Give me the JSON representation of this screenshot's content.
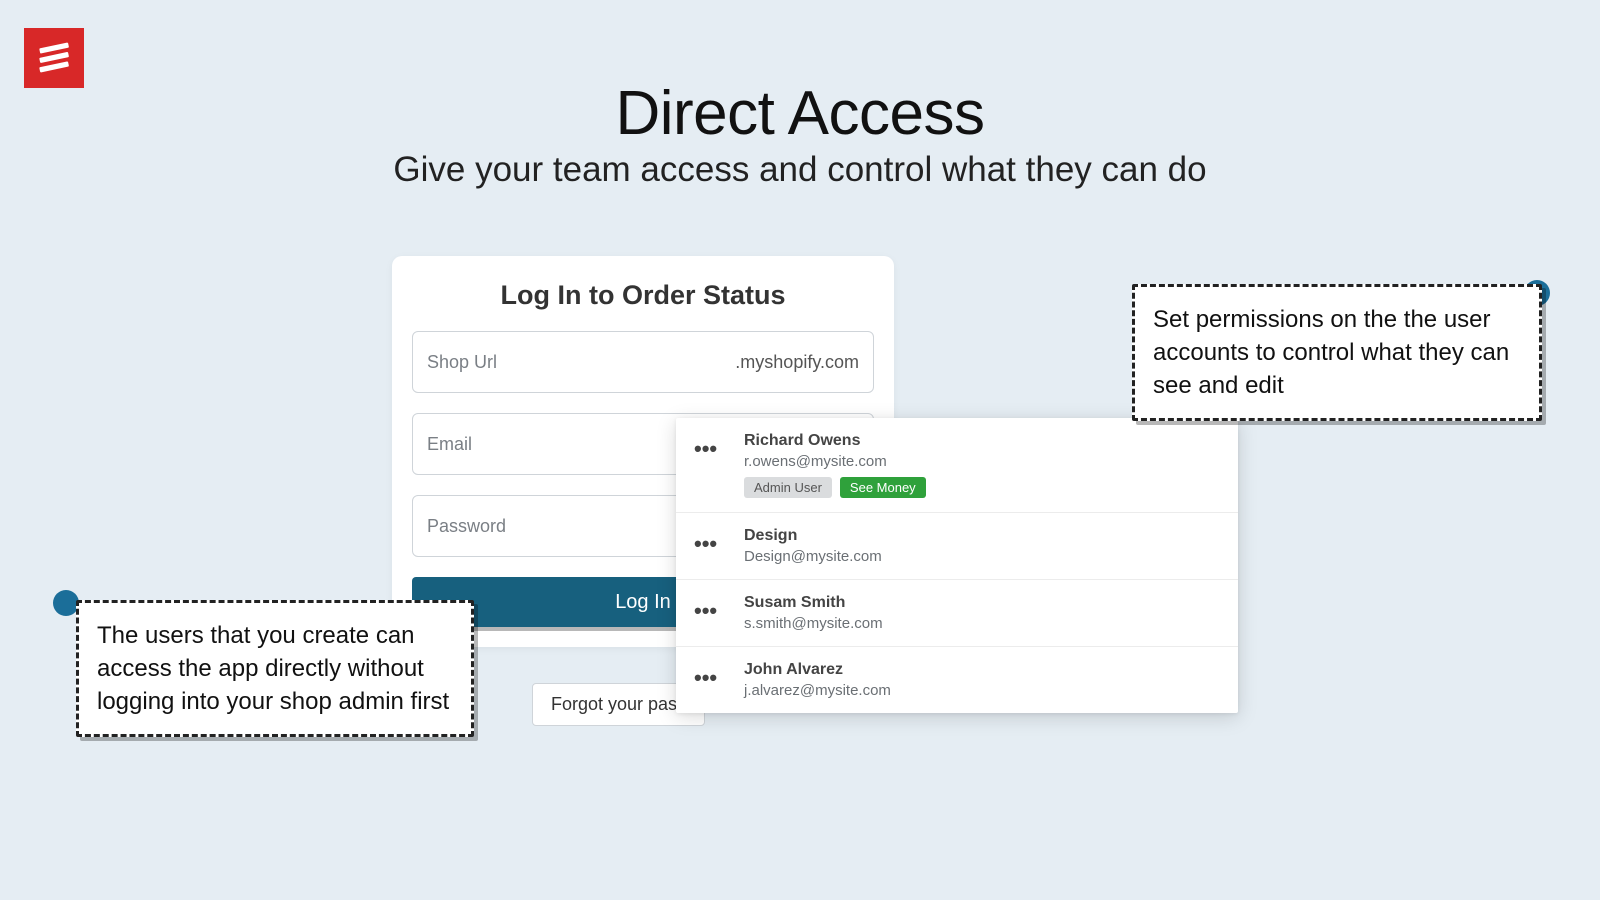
{
  "headline": "Direct Access",
  "subhead": "Give your team access and control what they can do",
  "login": {
    "title": "Log In to Order Status",
    "shop_url_placeholder": "Shop Url",
    "shop_url_suffix": ".myshopify.com",
    "email_placeholder": "Email",
    "password_placeholder": "Password",
    "login_button": "Log In",
    "forgot": "Forgot your pass"
  },
  "users": [
    {
      "name": "Richard Owens",
      "email": "r.owens@mysite.com",
      "badges": [
        {
          "label": "Admin User",
          "style": "grey"
        },
        {
          "label": "See Money",
          "style": "green"
        }
      ]
    },
    {
      "name": "Design",
      "email": "Design@mysite.com",
      "badges": []
    },
    {
      "name": "Susam Smith",
      "email": "s.smith@mysite.com",
      "badges": []
    },
    {
      "name": "John Alvarez",
      "email": "j.alvarez@mysite.com",
      "badges": []
    }
  ],
  "callouts": {
    "left": "The users that you create can access the app directly without logging into your shop admin first",
    "right": "Set permissions on the the user accounts to control what they can see and edit"
  }
}
